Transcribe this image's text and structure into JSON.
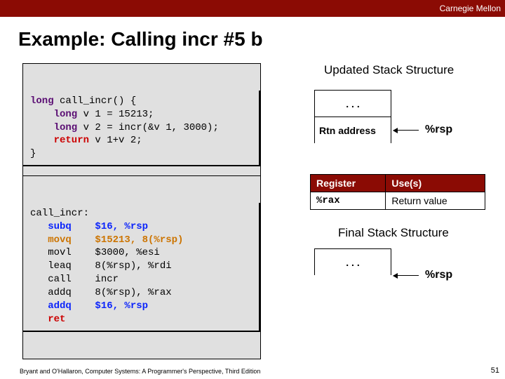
{
  "header": {
    "brand": "Carnegie Mellon"
  },
  "title": "Example: Calling incr #5 b",
  "code_c": {
    "l1a": "long",
    "l1b": " call_incr() {",
    "l2a": "    long",
    "l2b": " v 1 = 15213;",
    "l3a": "    long",
    "l3b": " v 2 = incr(&v 1, 3000);",
    "l4a": "    return",
    "l4b": " v 1+v 2;",
    "l5": "}"
  },
  "code_asm": {
    "label": "call_incr:",
    "r1a": "   subq",
    "r1b": "    $16, %rsp",
    "r2a": "   movq",
    "r2b": "    $15213, 8(%rsp)",
    "r3a": "   movl",
    "r3b": "    $3000, %esi",
    "r4a": "   leaq",
    "r4b": "    8(%rsp), %rdi",
    "r5a": "   call",
    "r5b": "    incr",
    "r6a": "   addq",
    "r6b": "    8(%rsp), %rax",
    "r7a": "   addq",
    "r7b": "    $16, %rsp",
    "r8": "   ret"
  },
  "stack": {
    "updated_title": "Updated Stack Structure",
    "updated_cells": {
      "c0": ". . .",
      "c1": "Rtn address"
    },
    "rsp": "%rsp",
    "final_title": "Final Stack Structure",
    "final_cells": {
      "c0": ". . ."
    }
  },
  "regtable": {
    "h0": "Register",
    "h1": "Use(s)",
    "r0c0": "%rax",
    "r0c1": "Return value"
  },
  "footer": "Bryant and O'Hallaron, Computer Systems: A Programmer's Perspective, Third Edition",
  "page": "51"
}
